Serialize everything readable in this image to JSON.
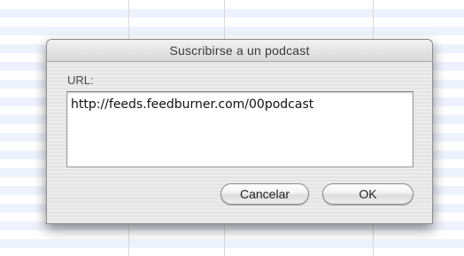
{
  "dialog": {
    "title": "Suscribirse a un podcast",
    "url_label": "URL:",
    "url_value": "http://feeds.feedburner.com/00podcast",
    "cancel_label": "Cancelar",
    "ok_label": "OK"
  },
  "colors": {
    "stripe_blue": "#edf3fe",
    "dialog_bg": "#ececec",
    "border": "#8f8f8f"
  }
}
